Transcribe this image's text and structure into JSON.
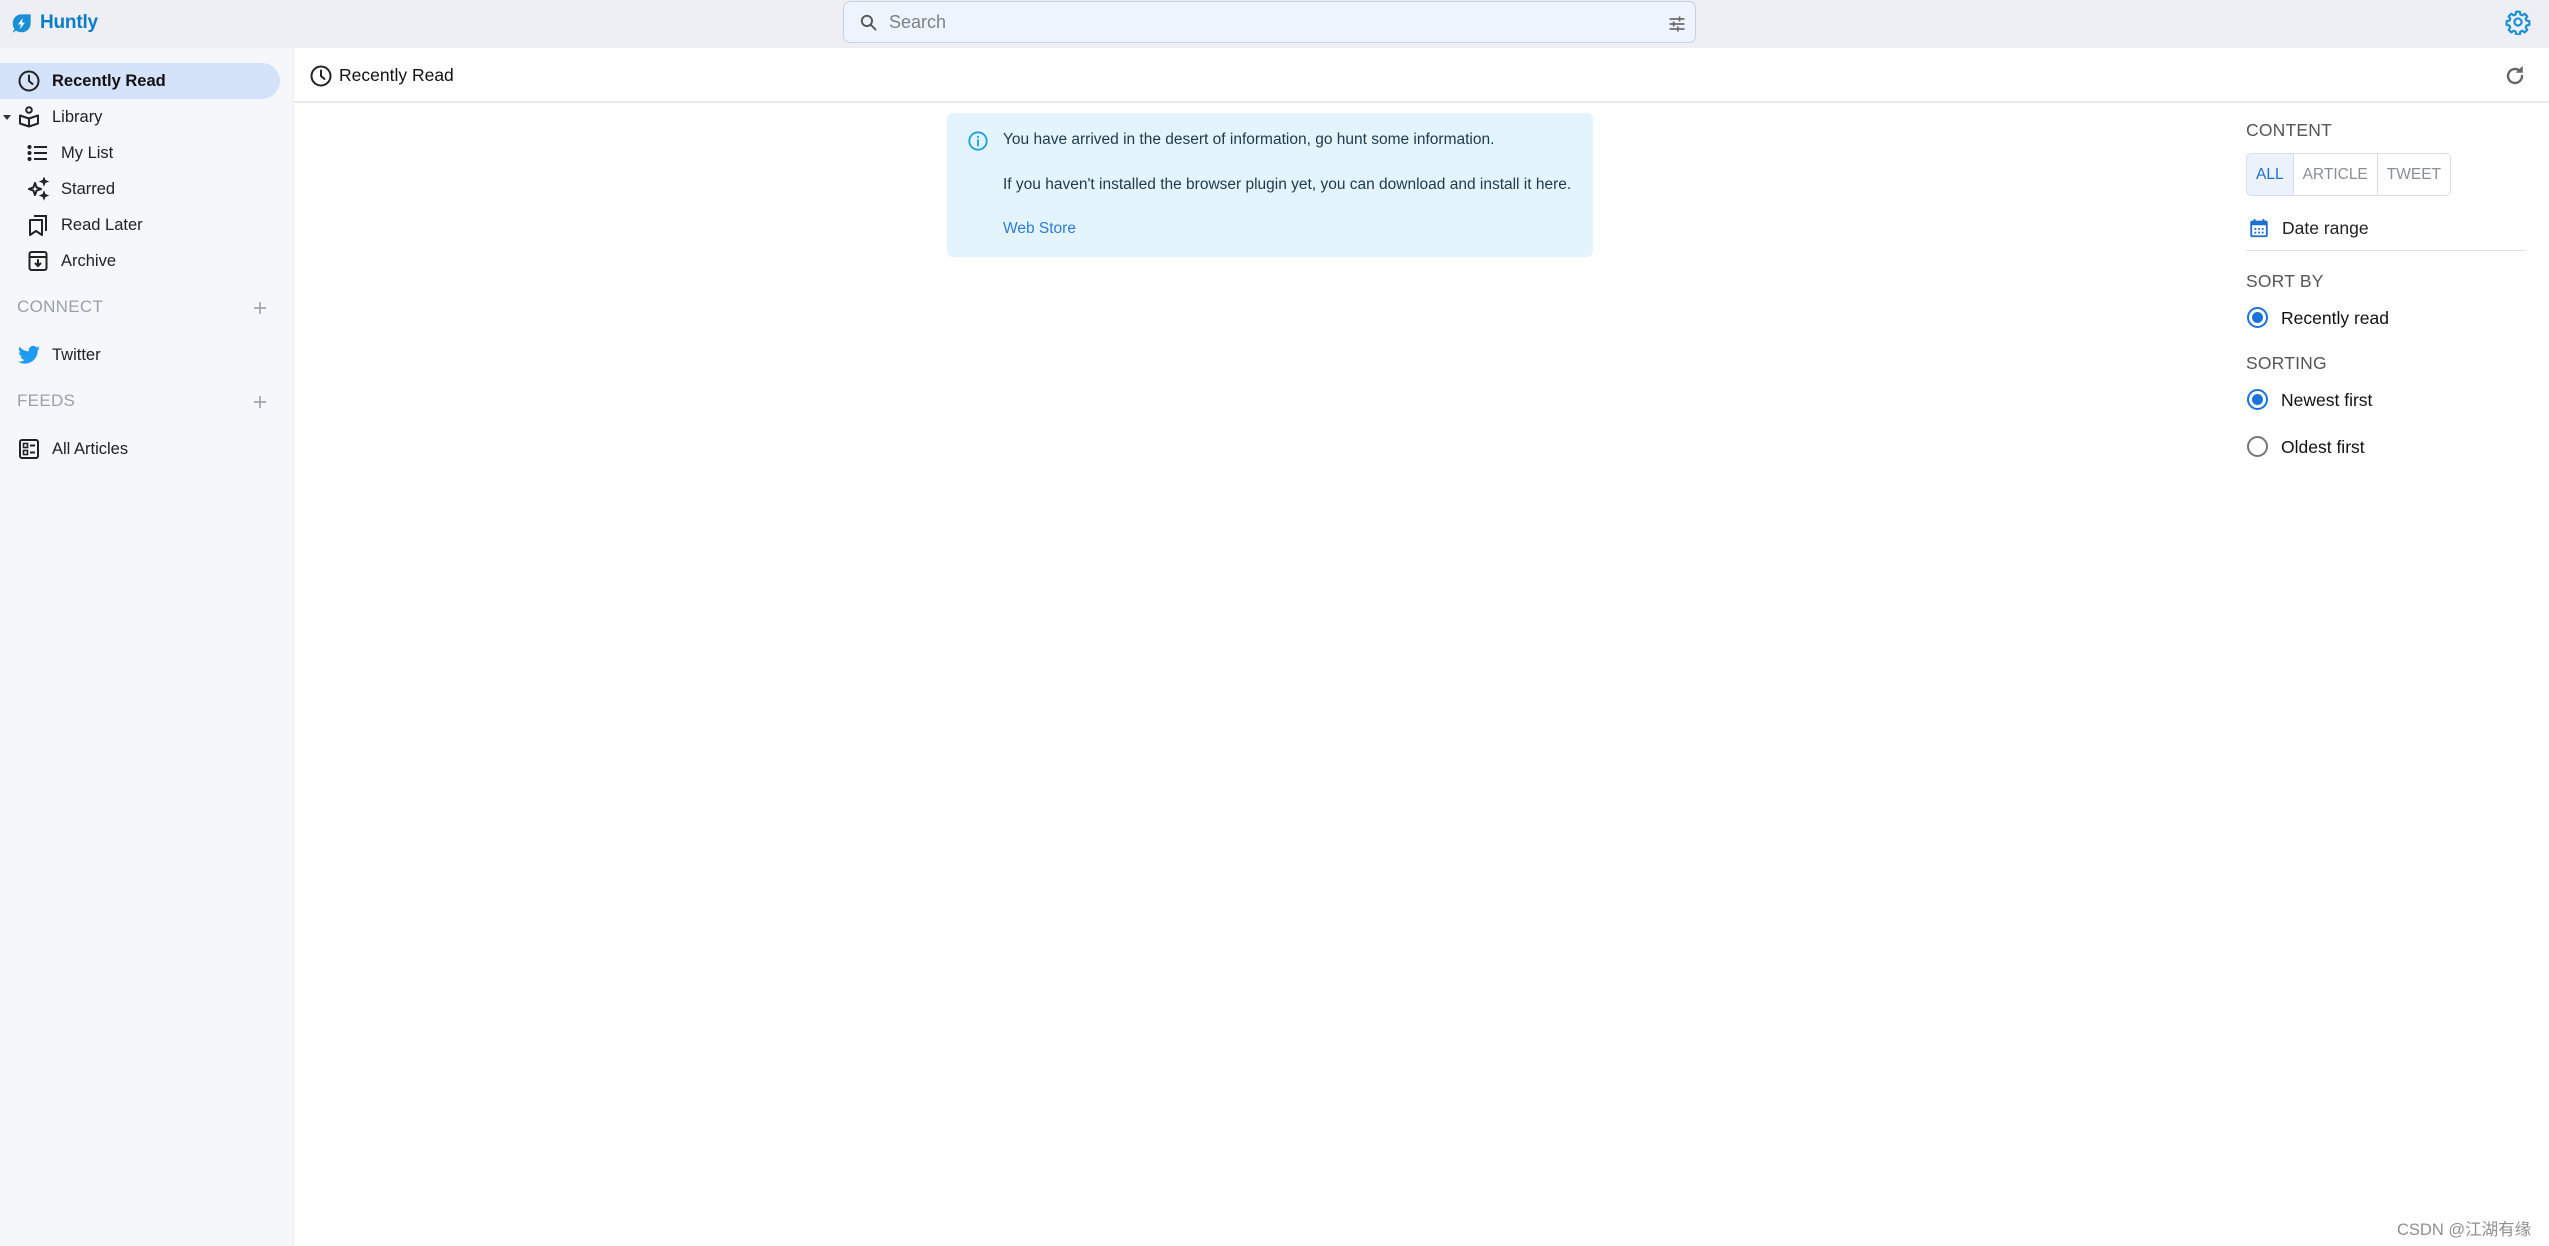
{
  "app": {
    "name": "Huntly",
    "brand_color": "#0b7dc6"
  },
  "topbar": {
    "search": {
      "placeholder": "Search",
      "value": ""
    },
    "icons": {
      "search": "search-icon",
      "filter": "sliders-icon",
      "settings": "gear-icon"
    }
  },
  "sidebar": {
    "items": [
      {
        "label": "Recently Read",
        "icon": "clock-icon",
        "active": true
      },
      {
        "label": "Library",
        "icon": "book-reader-icon",
        "expanded": true
      },
      {
        "label": "My List",
        "icon": "list-icon"
      },
      {
        "label": "Starred",
        "icon": "sparkles-icon"
      },
      {
        "label": "Read Later",
        "icon": "bookmarks-icon"
      },
      {
        "label": "Archive",
        "icon": "archive-icon"
      }
    ],
    "connect": {
      "title": "CONNECT",
      "items": [
        {
          "label": "Twitter",
          "icon": "twitter-icon"
        }
      ]
    },
    "feeds": {
      "title": "FEEDS",
      "items": [
        {
          "label": "All Articles",
          "icon": "articles-icon"
        }
      ]
    }
  },
  "main": {
    "title": "Recently Read",
    "alert": {
      "line1": "You have arrived in the desert of information, go hunt some information.",
      "line2": "If you haven't installed the browser plugin yet, you can download and install it here.",
      "link": "Web Store"
    }
  },
  "filters": {
    "content": {
      "title": "CONTENT",
      "options": [
        "ALL",
        "ARTICLE",
        "TWEET"
      ],
      "selected": "ALL"
    },
    "date_range": "Date range",
    "sort_by": {
      "title": "SORT BY",
      "options": [
        {
          "label": "Recently read",
          "checked": true
        }
      ]
    },
    "sorting": {
      "title": "SORTING",
      "options": [
        {
          "label": "Newest first",
          "checked": true
        },
        {
          "label": "Oldest first",
          "checked": false
        }
      ]
    },
    "accent_color": "#1a73d9"
  },
  "watermark": "CSDN @江湖有缘"
}
